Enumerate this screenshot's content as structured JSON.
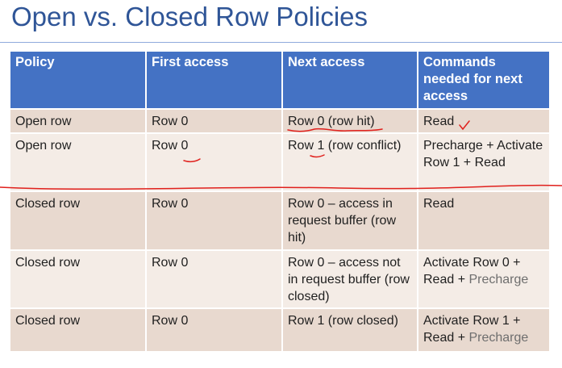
{
  "title": "Open vs. Closed Row Policies",
  "table": {
    "headers": [
      "Policy",
      "First access",
      "Next access",
      "Commands needed for next access"
    ],
    "rows": [
      {
        "policy": "Open row",
        "first": "Row 0",
        "next": "Row 0 (row hit)",
        "commands": "Read",
        "commands_gray": ""
      },
      {
        "policy": "Open row",
        "first": "Row 0",
        "next": "Row 1 (row conflict)",
        "commands": "Precharge + Activate Row 1 + Read",
        "commands_gray": ""
      },
      {
        "policy": "Closed row",
        "first": "Row 0",
        "next": "Row 0 – access in request buffer (row hit)",
        "commands": "Read",
        "commands_gray": ""
      },
      {
        "policy": "Closed row",
        "first": "Row 0",
        "next": "Row 0 – access not in request buffer (row closed)",
        "commands": "Activate Row 0 + Read + ",
        "commands_gray": "Precharge"
      },
      {
        "policy": "Closed row",
        "first": "Row 0",
        "next": "Row 1 (row closed)",
        "commands": "Activate Row 1 + Read + ",
        "commands_gray": "Precharge"
      }
    ]
  },
  "colors": {
    "title": "#2f5597",
    "header_bg": "#4472c4",
    "row_dark": "#e8d9cf",
    "row_light": "#f4ece6",
    "annotation_ink": "#e0201c"
  }
}
